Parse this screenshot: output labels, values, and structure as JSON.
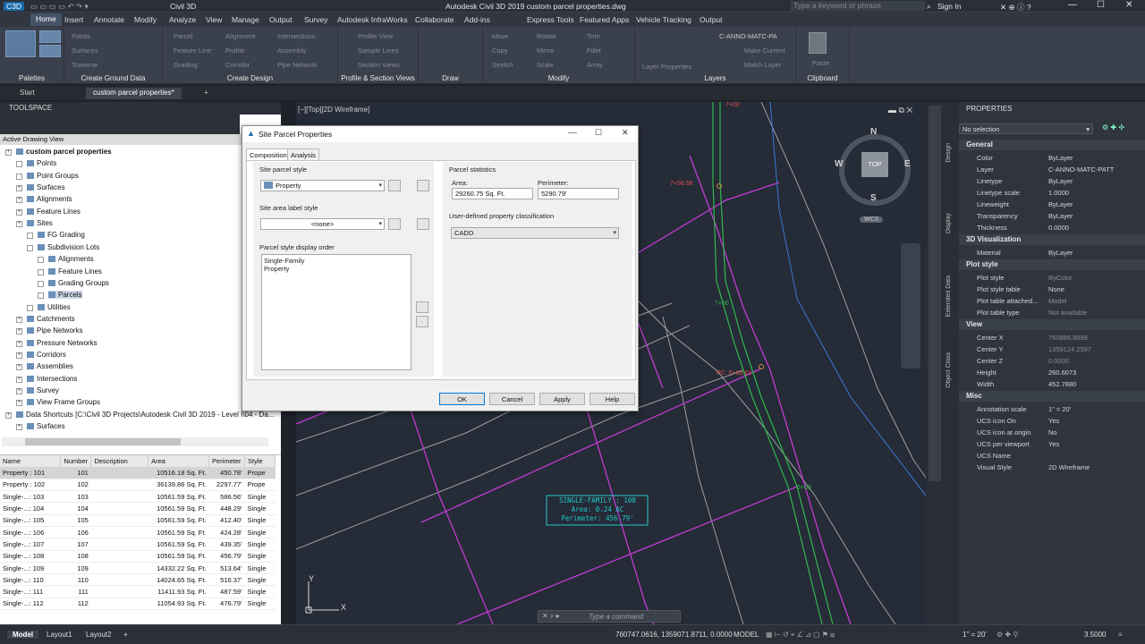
{
  "app": {
    "title": "Autodesk Civil 3D 2019    custom parcel properties.dwg",
    "product": "Civil 3D",
    "search_placeholder": "Type a keyword or phrase",
    "signin": "Sign In"
  },
  "ribbon_tabs": [
    "Home",
    "Insert",
    "Annotate",
    "Modify",
    "Analyze",
    "View",
    "Manage",
    "Output",
    "Survey",
    "Autodesk InfraWorks",
    "Collaborate",
    "Add-ins",
    "Express Tools",
    "Featured Apps",
    "Vehicle Tracking",
    "Output"
  ],
  "ribbon_panels": [
    "Palettes",
    "Create Ground Data",
    "Create Design",
    "Profile & Section Views",
    "Draw",
    "Modify",
    "Layers",
    "Clipboard"
  ],
  "ribbon_items": {
    "create_design": [
      "Parcel",
      "Feature Line",
      "Grading",
      "Alignment",
      "Profile",
      "Corridor",
      "Intersections",
      "Assembly",
      "Pipe Network"
    ],
    "profile_section": [
      "Profile View",
      "Sample Lines",
      "Section Views"
    ],
    "modify": [
      "Move",
      "Rotate",
      "Trim",
      "Copy",
      "Mirror",
      "Fillet",
      "Stretch",
      "Scale",
      "Array"
    ],
    "layers": [
      "C-ANNO-MATC-PA",
      "Make Current",
      "Match Layer"
    ],
    "clipboard": [
      "Paste"
    ],
    "create_ground": [
      "Points",
      "Surfaces",
      "Traverse"
    ],
    "layer_properties": "Layer Properties"
  },
  "doc_tabs": [
    "Start",
    "custom parcel properties*"
  ],
  "toolspace": {
    "title": "TOOLSPACE",
    "view_label": "Active Drawing View",
    "tree": [
      {
        "label": "custom parcel properties",
        "level": 0,
        "bold": true
      },
      {
        "label": "Points",
        "level": 1
      },
      {
        "label": "Point Groups",
        "level": 1
      },
      {
        "label": "Surfaces",
        "level": 1
      },
      {
        "label": "Alignments",
        "level": 1
      },
      {
        "label": "Feature Lines",
        "level": 1
      },
      {
        "label": "Sites",
        "level": 1
      },
      {
        "label": "FG Grading",
        "level": 2
      },
      {
        "label": "Subdivision Lots",
        "level": 2
      },
      {
        "label": "Alignments",
        "level": 3
      },
      {
        "label": "Feature Lines",
        "level": 3
      },
      {
        "label": "Grading Groups",
        "level": 3
      },
      {
        "label": "Parcels",
        "level": 3,
        "selected": true
      },
      {
        "label": "Utilities",
        "level": 2
      },
      {
        "label": "Catchments",
        "level": 1
      },
      {
        "label": "Pipe Networks",
        "level": 1
      },
      {
        "label": "Pressure Networks",
        "level": 1
      },
      {
        "label": "Corridors",
        "level": 1
      },
      {
        "label": "Assemblies",
        "level": 1
      },
      {
        "label": "Intersections",
        "level": 1
      },
      {
        "label": "Survey",
        "level": 1
      },
      {
        "label": "View Frame Groups",
        "level": 1
      },
      {
        "label": "Data Shortcuts [C:\\Civil 3D Projects\\Autodesk Civil 3D 2019 - Level I\\04 - Da...",
        "level": 0
      },
      {
        "label": "Surfaces",
        "level": 1
      }
    ],
    "grid_headers": [
      "Name",
      "Number",
      "Description",
      "Area",
      "Perimeter",
      "Style"
    ],
    "grid_rows": [
      [
        "Property : 101",
        "101",
        "",
        "10516.18 Sq. Ft.",
        "450.78'",
        "Prope"
      ],
      [
        "Property : 102",
        "102",
        "",
        "36139.86 Sq. Ft.",
        "2297.77'",
        "Prope"
      ],
      [
        "Single-...: 103",
        "103",
        "",
        "10561.59 Sq. Ft.",
        "586.56'",
        "Single"
      ],
      [
        "Single-...: 104",
        "104",
        "",
        "10561.59 Sq. Ft.",
        "448.29'",
        "Single"
      ],
      [
        "Single-...: 105",
        "105",
        "",
        "10561.59 Sq. Ft.",
        "412.40'",
        "Single"
      ],
      [
        "Single-...: 106",
        "106",
        "",
        "10561.59 Sq. Ft.",
        "424.28'",
        "Single"
      ],
      [
        "Single-...: 107",
        "107",
        "",
        "10561.59 Sq. Ft.",
        "439.35'",
        "Single"
      ],
      [
        "Single-...: 108",
        "108",
        "",
        "10561.59 Sq. Ft.",
        "456.79'",
        "Single"
      ],
      [
        "Single-...: 109",
        "109",
        "",
        "14332.22 Sq. Ft.",
        "513.64'",
        "Single"
      ],
      [
        "Single-...: 110",
        "110",
        "",
        "14024.65 Sq. Ft.",
        "516.37'",
        "Single"
      ],
      [
        "Single-...: 111",
        "111",
        "",
        "11411.93 Sq. Ft.",
        "487.59'",
        "Single"
      ],
      [
        "Single-...: 112",
        "112",
        "",
        "11054.93 Sq. Ft.",
        "476.79'",
        "Single"
      ]
    ]
  },
  "viewport": {
    "tag": "[−][Top][2D Wireframe]",
    "compass": {
      "n": "N",
      "s": "S",
      "e": "E",
      "w": "W",
      "top": "TOP",
      "wcs": "WCS"
    },
    "labels": {
      "station1": "7+00",
      "station2": "7+56.58",
      "station3": "7+00",
      "station4": "6+00",
      "pc": "PC: 6+65.61",
      "parcel_line1": "SINGLE-FAMILY : 108",
      "parcel_line2": "Area: 0.24 AC",
      "parcel_line3": "Perimeter: 456.79'",
      "cmd_placeholder": "Type a command"
    }
  },
  "dialog": {
    "title": "Site Parcel Properties",
    "tabs": [
      "Composition",
      "Analysis"
    ],
    "site_parcel_style_label": "Site parcel style",
    "site_parcel_style": "Property",
    "site_area_label_style_label": "Site area label style",
    "site_area_label_style": "<none>",
    "display_order_label": "Parcel style display order",
    "display_order": [
      "Single-Family",
      "Property"
    ],
    "parcel_stats_label": "Parcel statistics",
    "area_label": "Area:",
    "area_value": "29260.75 Sq. Ft.",
    "perimeter_label": "Perimeter:",
    "perimeter_value": "5290.79'",
    "user_class_label": "User-defined property classification",
    "user_class_value": "CADD",
    "buttons": {
      "ok": "OK",
      "cancel": "Cancel",
      "apply": "Apply",
      "help": "Help"
    }
  },
  "properties": {
    "title": "PROPERTIES",
    "selection": "No selection",
    "sections": [
      {
        "name": "General",
        "rows": [
          [
            "Color",
            "ByLayer"
          ],
          [
            "Layer",
            "C-ANNO-MATC-PATT"
          ],
          [
            "Linetype",
            "ByLayer"
          ],
          [
            "Linetype scale",
            "1.0000"
          ],
          [
            "Lineweight",
            "ByLayer"
          ],
          [
            "Transparency",
            "ByLayer"
          ],
          [
            "Thickness",
            "0.0000"
          ]
        ]
      },
      {
        "name": "3D Visualization",
        "rows": [
          [
            "Material",
            "ByLayer"
          ]
        ]
      },
      {
        "name": "Plot style",
        "rows": [
          [
            "Plot style",
            "ByColor"
          ],
          [
            "Plot style table",
            "None"
          ],
          [
            "Plot table attached...",
            "Model"
          ],
          [
            "Plot table type",
            "Not available"
          ]
        ]
      },
      {
        "name": "View",
        "rows": [
          [
            "Center X",
            "760886.8899"
          ],
          [
            "Center Y",
            "1359124.2597"
          ],
          [
            "Center Z",
            "0.0000"
          ],
          [
            "Height",
            "260.6073"
          ],
          [
            "Width",
            "452.7880"
          ]
        ]
      },
      {
        "name": "Misc",
        "rows": [
          [
            "Annotation scale",
            "1\" = 20'"
          ],
          [
            "UCS icon On",
            "Yes"
          ],
          [
            "UCS icon at origin",
            "No"
          ],
          [
            "UCS per viewport",
            "Yes"
          ],
          [
            "UCS Name",
            ""
          ],
          [
            "Visual Style",
            "2D Wireframe"
          ]
        ]
      }
    ],
    "side_tabs": [
      "Design",
      "Display",
      "Extended Data",
      "Object Class"
    ]
  },
  "statusbar": {
    "tabs": [
      "Model",
      "Layout1",
      "Layout2"
    ],
    "coords": "760747.0616, 1359071.8711, 0.0000",
    "mode": "MODEL",
    "scale": "1\" = 20'",
    "value": "3.5000"
  },
  "colors": {
    "accent": "#0078d7",
    "parcel_line": "#c23bd4",
    "alignment": "#2fb84a",
    "label_cyan": "#22c9c9",
    "cursor": "#26b5a0"
  }
}
